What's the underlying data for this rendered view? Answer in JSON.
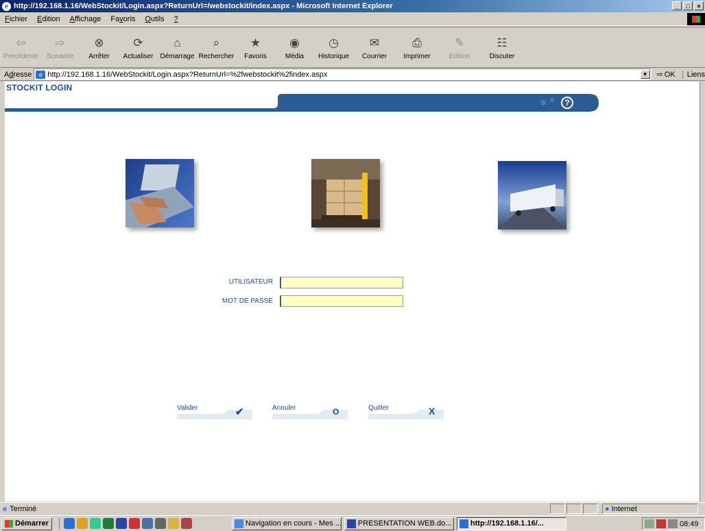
{
  "window": {
    "title": "http://192.168.1.16/WebStockit/Login.aspx?ReturnUrl=/webstockit/index.aspx - Microsoft Internet Explorer",
    "controls": [
      "_",
      "□",
      "×"
    ]
  },
  "menu": {
    "items": [
      {
        "pre": "",
        "key": "F",
        "post": "ichier"
      },
      {
        "pre": "",
        "key": "E",
        "post": "dition"
      },
      {
        "pre": "",
        "key": "A",
        "post": "ffichage"
      },
      {
        "pre": "Fa",
        "key": "v",
        "post": "oris"
      },
      {
        "pre": "",
        "key": "O",
        "post": "utils"
      },
      {
        "pre": "",
        "key": "?",
        "post": ""
      }
    ]
  },
  "toolbar": {
    "items": [
      {
        "label": "Précédente",
        "icon": "back-arrow-icon",
        "glyph": "⇦",
        "enabled": false
      },
      {
        "label": "Suivante",
        "icon": "forward-arrow-icon",
        "glyph": "⇨",
        "enabled": false
      },
      {
        "label": "Arrêter",
        "icon": "stop-icon",
        "glyph": "⊗",
        "enabled": true
      },
      {
        "label": "Actualiser",
        "icon": "refresh-icon",
        "glyph": "⟳",
        "enabled": true
      },
      {
        "label": "Démarrage",
        "icon": "home-icon",
        "glyph": "⌂",
        "enabled": true
      },
      {
        "label": "Rechercher",
        "icon": "search-icon",
        "glyph": "⌕",
        "enabled": true
      },
      {
        "label": "Favoris",
        "icon": "favorites-icon",
        "glyph": "★",
        "enabled": true
      },
      {
        "label": "Média",
        "icon": "media-icon",
        "glyph": "◉",
        "enabled": true
      },
      {
        "label": "Historique",
        "icon": "history-icon",
        "glyph": "◷",
        "enabled": true
      },
      {
        "label": "Courrier",
        "icon": "mail-icon",
        "glyph": "✉",
        "enabled": true
      },
      {
        "label": "Imprimer",
        "icon": "print-icon",
        "glyph": "⎙",
        "enabled": true
      },
      {
        "label": "Edition",
        "icon": "edit-icon",
        "glyph": "✎",
        "enabled": false
      },
      {
        "label": "Discuter",
        "icon": "discuss-icon",
        "glyph": "☷",
        "enabled": true
      }
    ]
  },
  "address": {
    "label_pre": "A",
    "label_key": "d",
    "label_post": "resse",
    "url": "http://192.168.1.16/WebStockit/Login.aspx?ReturnUrl=%2fwebstockit%2findex.aspx",
    "go_label": "OK",
    "links_label": "Liens"
  },
  "page": {
    "title": "STOCKIT LOGIN",
    "help_glyph": "?",
    "form": {
      "user_label": "UTILISATEUR",
      "user_value": "",
      "password_label": "MOT DE PASSE",
      "password_value": ""
    },
    "buttons": {
      "validate": "Valider",
      "cancel": "Annuler",
      "quit": "Quitter"
    }
  },
  "status": {
    "text": "Terminé",
    "zone": "Internet"
  },
  "taskbar": {
    "start": "Démarrer",
    "tasks": [
      {
        "label": "Navigation en cours - Mes ...",
        "active": false
      },
      {
        "label": "PRESENTATION WEB.do...",
        "active": false
      },
      {
        "label": "http://192.168.1.16/...",
        "active": true
      }
    ],
    "clock": "08:49"
  },
  "colors": {
    "brand_blue": "#1b4aa4",
    "banner_blue": "#2b5d94",
    "input_yellow": "#ffffc6"
  }
}
